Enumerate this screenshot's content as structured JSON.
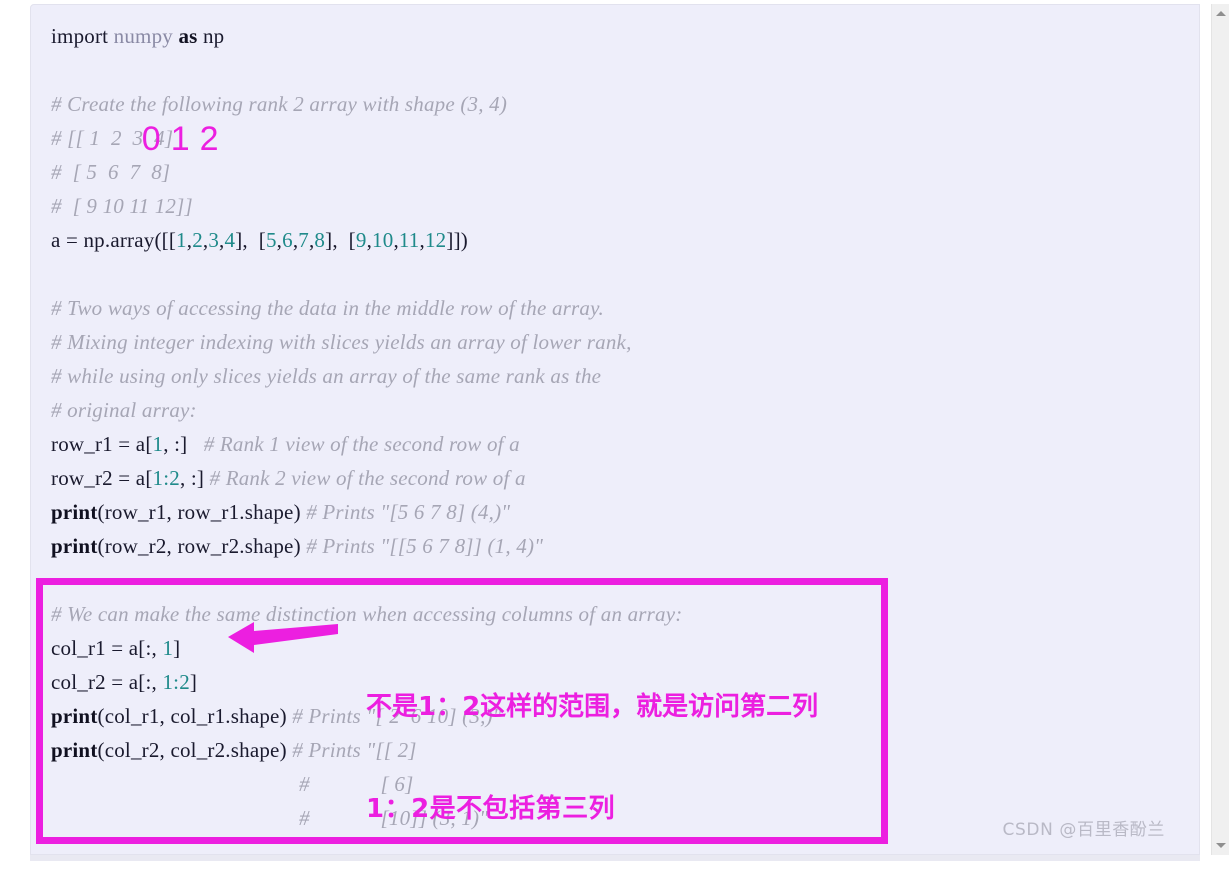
{
  "editor": {
    "background_color": "#eeeefa",
    "comment_color": "#a6a6b5",
    "number_color": "#1f8a8a",
    "accent_color": "#ec1fe0",
    "lines": {
      "l1_import": "import ",
      "l1_numpy": "numpy ",
      "l1_as": "as",
      "l1_np": " np",
      "l2_blank": "",
      "l3_comment": "# Create the following rank 2 array with shape (3, 4)",
      "l4_comment": "# [[ 1  2  3  4]",
      "l5_comment": "#  [ 5  6  7  8]",
      "l6_comment": "#  [ 9 10 11 12]]",
      "l7_a": "a = np.array([[",
      "l7_n1": "1",
      "l7_c1": ",",
      "l7_n2": "2",
      "l7_c2": ",",
      "l7_n3": "3",
      "l7_c3": ",",
      "l7_n4": "4",
      "l7_mid1": "],  [",
      "l7_n5": "5",
      "l7_n6": "6",
      "l7_n7": "7",
      "l7_n8": "8",
      "l7_mid2": "],  [",
      "l7_n9": "9",
      "l7_n10": "10",
      "l7_n11": "11",
      "l7_n12": "12",
      "l7_end": "]])",
      "l9_comment": "# Two ways of accessing the data in the middle row of the array.",
      "l10_comment": "# Mixing integer indexing with slices yields an array of lower rank,",
      "l11_comment": "# while using only slices yields an array of the same rank as the",
      "l12_comment": "# original array:",
      "l13_code": "row_r1 = a[",
      "l13_idx": "1",
      "l13_rest": ", :]",
      "l13_comment": "   # Rank 1 view of the second row of a",
      "l14_code": "row_r2 = a[",
      "l14_idx": "1:2",
      "l14_rest": ", :]",
      "l14_comment": " # Rank 2 view of the second row of a",
      "l15_fn": "print",
      "l15_args": "(row_r1, row_r1.shape)",
      "l15_comment": " # Prints \"[5 6 7 8] (4,)\"",
      "l16_fn": "print",
      "l16_args": "(row_r2, row_r2.shape)",
      "l16_comment": " # Prints \"[[5 6 7 8]] (1, 4)\"",
      "l18_comment": "# We can make the same distinction when accessing columns of an array:",
      "l19_code": "col_r1 = a[:, ",
      "l19_idx": "1",
      "l19_rest": "]",
      "l20_code": "col_r2 = a[:, ",
      "l20_idx": "1:2",
      "l20_rest": "]",
      "l21_fn": "print",
      "l21_args": "(col_r1, col_r1.shape)",
      "l21_comment": " # Prints \"[ 2  6 10] (3,)\"",
      "l22_fn": "print",
      "l22_args": "(col_r2, col_r2.shape)",
      "l22_comment": " # Prints \"[[ 2]",
      "l23_comment": "#             [ 6]",
      "l24_comment": "#             [10]] (3, 1)\""
    }
  },
  "annotations": {
    "index_digits": [
      "0",
      "1",
      "2"
    ],
    "arrow_direction": "left",
    "note_line_1": "不是1：2这样的范围，就是访问第二列",
    "note_line_2": "1：2是不包括第三列",
    "highlight_box_color": "#ec1fe0"
  },
  "watermark": {
    "text": "CSDN @百里香酚兰"
  },
  "scrollbar": {
    "up_arrow": "▲",
    "down_arrow": "▼"
  }
}
